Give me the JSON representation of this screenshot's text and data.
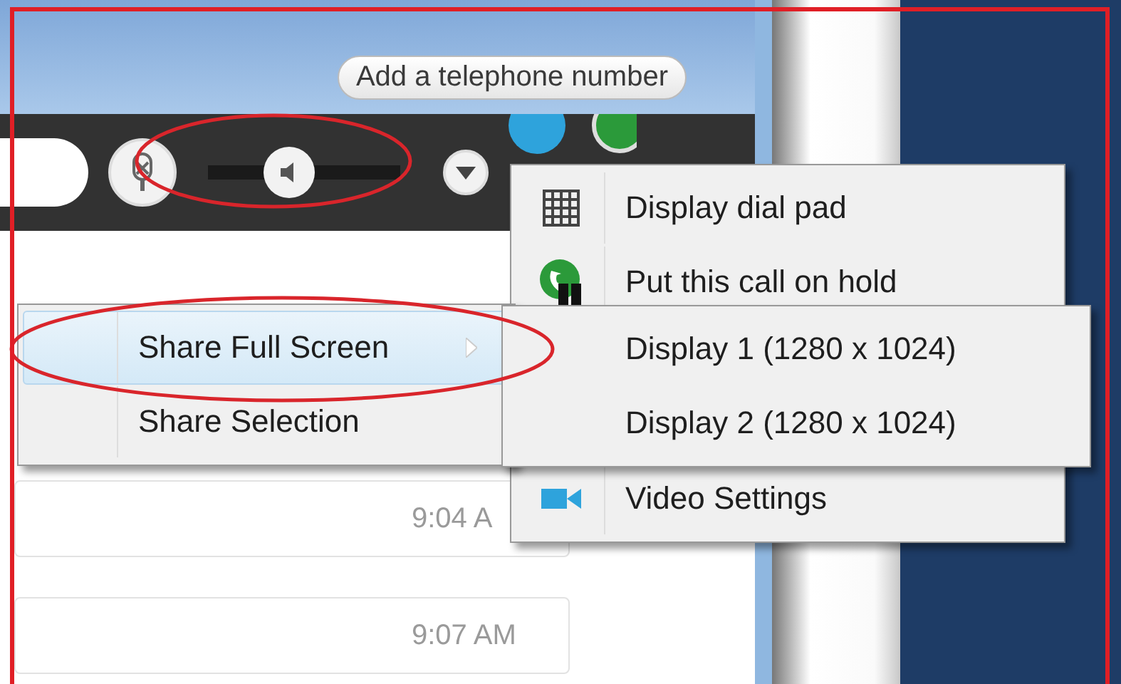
{
  "header": {
    "phone_button": "Add a telephone number"
  },
  "toolbar": {
    "volume": {
      "level": 0.42
    }
  },
  "messages": [
    {
      "time": "9:04 A"
    },
    {
      "time": "9:07 AM"
    }
  ],
  "call_menu": {
    "items": [
      {
        "kind": "dialpad",
        "label": "Display dial pad"
      },
      {
        "kind": "hold",
        "label": "Put this call on hold"
      },
      {
        "kind": "video",
        "label": "Video Settings"
      }
    ]
  },
  "share_menu": {
    "items": [
      {
        "label": "Share Full Screen",
        "selected": true,
        "submenu": true
      },
      {
        "label": "Share Selection",
        "selected": false,
        "submenu": false
      }
    ]
  },
  "display_menu": {
    "items": [
      {
        "label": "Display 1 (1280 x 1024)"
      },
      {
        "label": "Display 2 (1280 x 1024)"
      }
    ]
  }
}
